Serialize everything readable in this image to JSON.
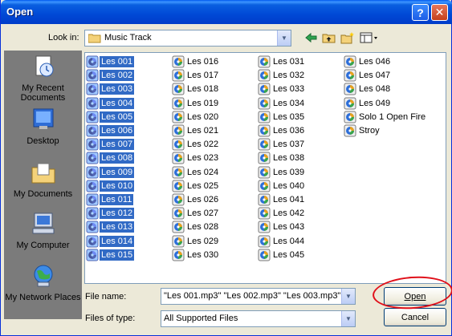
{
  "window": {
    "title": "Open",
    "help_glyph": "?",
    "close_glyph": "✕"
  },
  "lookin": {
    "label": "Look in:",
    "value": "Music Track",
    "icons": [
      "back-arrow-icon",
      "up-folder-icon",
      "new-folder-icon",
      "view-menu-icon"
    ]
  },
  "places": [
    {
      "label": "My Recent Documents",
      "icon": "recent-documents-icon"
    },
    {
      "label": "Desktop",
      "icon": "desktop-icon"
    },
    {
      "label": "My Documents",
      "icon": "my-documents-icon"
    },
    {
      "label": "My Computer",
      "icon": "my-computer-icon"
    },
    {
      "label": "My Network Places",
      "icon": "network-places-icon"
    }
  ],
  "files": {
    "icon": "media-file-icon",
    "selected_color": "#316ac5",
    "columns": [
      {
        "items": [
          "Les 001",
          "Les 002",
          "Les 003",
          "Les 004",
          "Les 005",
          "Les 006",
          "Les 007",
          "Les 008",
          "Les 009",
          "Les 010",
          "Les 011",
          "Les 012",
          "Les 013",
          "Les 014",
          "Les 015"
        ],
        "selected": true
      },
      {
        "items": [
          "Les 016",
          "Les 017",
          "Les 018",
          "Les 019",
          "Les 020",
          "Les 021",
          "Les 022",
          "Les 023",
          "Les 024",
          "Les 025",
          "Les 026",
          "Les 027",
          "Les 028",
          "Les 029",
          "Les 030"
        ],
        "selected": false
      },
      {
        "items": [
          "Les 031",
          "Les 032",
          "Les 033",
          "Les 034",
          "Les 035",
          "Les 036",
          "Les 037",
          "Les 038",
          "Les 039",
          "Les 040",
          "Les 041",
          "Les 042",
          "Les 043",
          "Les 044",
          "Les 045"
        ],
        "selected": false
      },
      {
        "items": [
          "Les 046",
          "Les 047",
          "Les 048",
          "Les 049",
          "Solo 1 Open Fire",
          "Stroy"
        ],
        "selected": false
      }
    ]
  },
  "filename": {
    "label": "File name:",
    "value": "\"Les 001.mp3\" \"Les 002.mp3\" \"Les 003.mp3\""
  },
  "filetype": {
    "label": "Files of type:",
    "value": "All Supported Files"
  },
  "buttons": {
    "open": "Open",
    "cancel": "Cancel"
  },
  "annotation_color": "#e0101a"
}
